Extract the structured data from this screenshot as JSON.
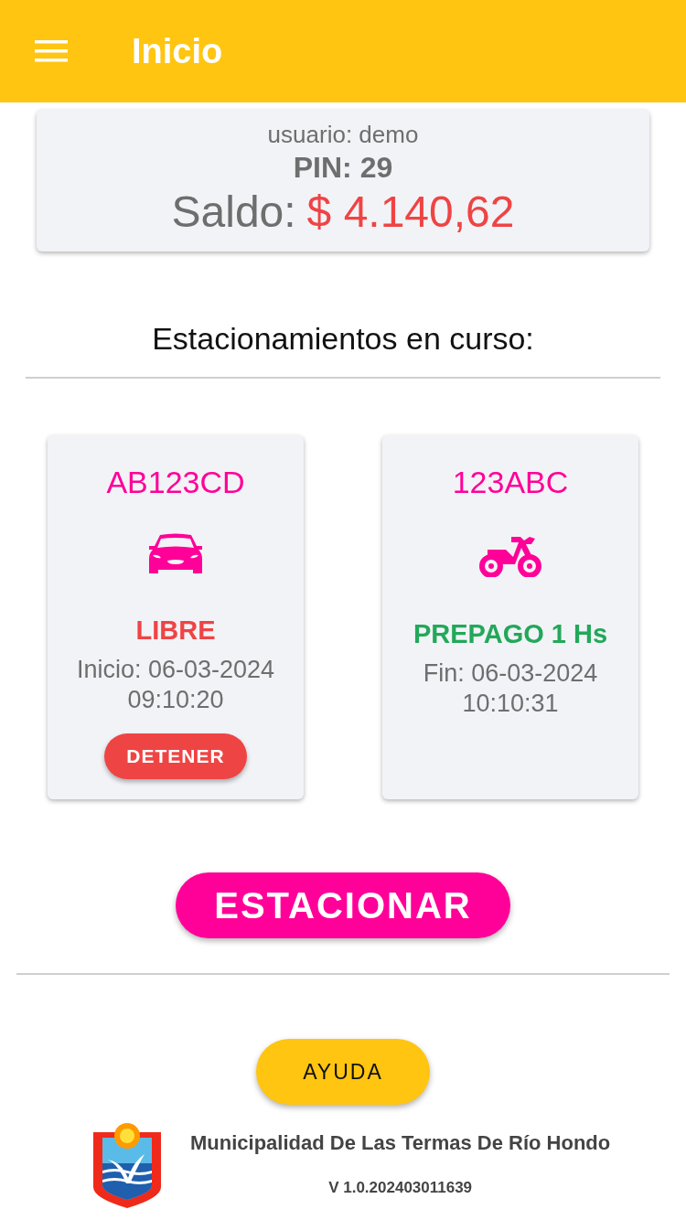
{
  "app_bar": {
    "title": "Inicio"
  },
  "account": {
    "user": "usuario: demo",
    "pin": "PIN: 29",
    "balance_label": "Saldo:",
    "balance": "$ 4.140,62"
  },
  "section_title": "Estacionamientos en curso:",
  "parkings": [
    {
      "plate": "AB123CD",
      "kind": "car",
      "status": "LIBRE",
      "color": "#ef4444",
      "time_line_1": "Inicio: 06-03-2024",
      "time_line_2": "09:10:20",
      "stop_button": "DETENER"
    },
    {
      "plate": "123ABC",
      "kind": "motorcycle",
      "status": "PREPAGO 1 Hs",
      "color": "#22a85a",
      "time_line_1": "Fin: 06-03-2024",
      "time_line_2": "10:10:31"
    }
  ],
  "park_button": "ESTACIONAR",
  "help_button": "AYUDA",
  "footer": {
    "organization": "Municipalidad De Las Termas De Río Hondo",
    "version": "V 1.0.202403011639"
  }
}
